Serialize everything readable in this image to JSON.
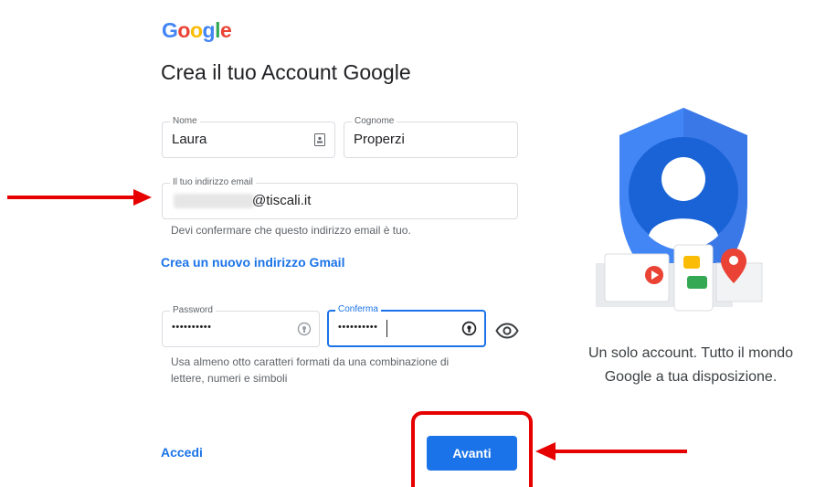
{
  "logo": {
    "letters": [
      "G",
      "o",
      "o",
      "g",
      "l",
      "e"
    ],
    "colors": [
      "#4285F4",
      "#EA4335",
      "#FBBC05",
      "#4285F4",
      "#34A853",
      "#EA4335"
    ]
  },
  "page_title": "Crea il tuo Account Google",
  "first_name": {
    "label": "Nome",
    "value": "Laura"
  },
  "last_name": {
    "label": "Cognome",
    "value": "Properzi"
  },
  "email": {
    "label": "Il tuo indirizzo email",
    "value": "@tiscali.it",
    "hint": "Devi confermare che questo indirizzo email è tuo."
  },
  "gmail_link": "Crea un nuovo indirizzo Gmail",
  "password": {
    "label": "Password",
    "value": "••••••••••"
  },
  "confirm": {
    "label": "Conferma",
    "value": "••••••••••"
  },
  "password_hint": [
    "Usa almeno otto caratteri formati da una combinazione di",
    "lettere, numeri e simboli"
  ],
  "signin_link": "Accedi",
  "next_button": "Avanti",
  "illustration_caption": [
    "Un solo account. Tutto il mondo",
    "Google a tua disposizione."
  ],
  "colors": {
    "accent": "#1a73e8",
    "annotation_red": "#e60000"
  },
  "icons": [
    "contact-card-icon",
    "fingerprint-key-icon",
    "eye-icon",
    "left-arrow-annotation",
    "right-arrow-annotation"
  ]
}
